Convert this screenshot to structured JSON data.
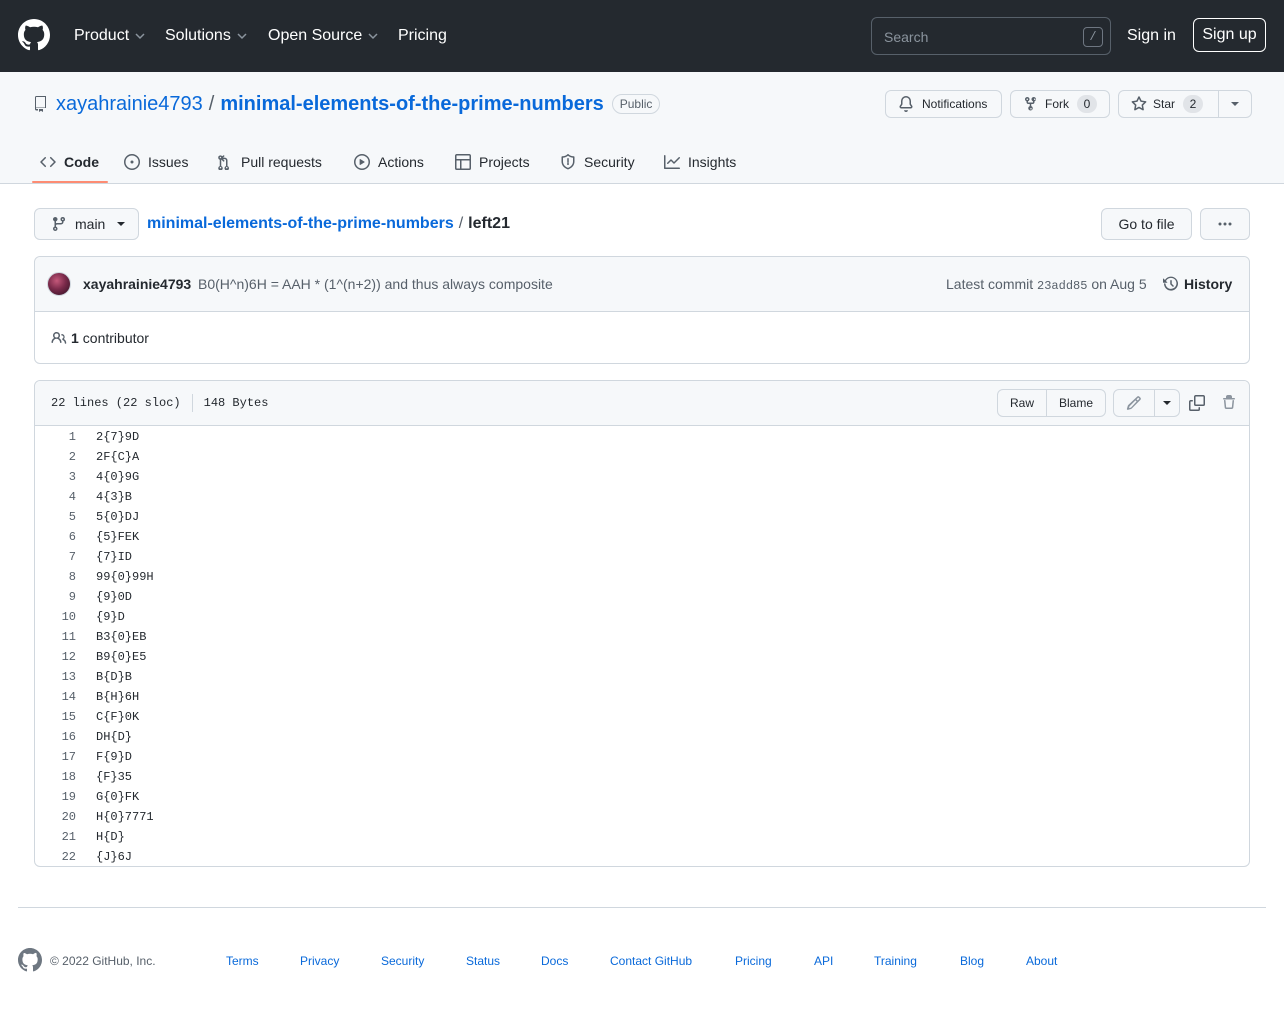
{
  "header": {
    "nav": [
      {
        "label": "Product"
      },
      {
        "label": "Solutions"
      },
      {
        "label": "Open Source"
      },
      {
        "label": "Pricing"
      }
    ],
    "search_placeholder": "Search",
    "search_shortcut": "/",
    "sign_in": "Sign in",
    "sign_up": "Sign up"
  },
  "repo": {
    "owner": "xayahrainie4793",
    "separator": "/",
    "name": "minimal-elements-of-the-prime-numbers",
    "visibility": "Public",
    "notifications_label": "Notifications",
    "fork_label": "Fork",
    "fork_count": "0",
    "star_label": "Star",
    "star_count": "2"
  },
  "tabs": [
    {
      "label": "Code",
      "icon": "code-icon",
      "active": true
    },
    {
      "label": "Issues",
      "icon": "issue-opened-icon"
    },
    {
      "label": "Pull requests",
      "icon": "git-pull-request-icon"
    },
    {
      "label": "Actions",
      "icon": "play-icon"
    },
    {
      "label": "Projects",
      "icon": "table-icon"
    },
    {
      "label": "Security",
      "icon": "shield-icon"
    },
    {
      "label": "Insights",
      "icon": "graph-icon"
    }
  ],
  "file_nav": {
    "branch": "main",
    "breadcrumb_repo": "minimal-elements-of-the-prime-numbers",
    "breadcrumb_sep": "/",
    "file_name": "left21",
    "go_to_file": "Go to file"
  },
  "commit": {
    "author": "xayahrainie4793",
    "message": "B0(H^n)6H = AAH * (1^(n+2)) and thus always composite",
    "latest_label": "Latest commit",
    "sha": "23add85",
    "date": "on Aug 5",
    "history_label": "History",
    "contributors_count": "1",
    "contributors_label": "contributor"
  },
  "file": {
    "lines_info": "22 lines (22 sloc)",
    "size": "148 Bytes",
    "raw_label": "Raw",
    "blame_label": "Blame",
    "lines": [
      "2{7}9D",
      "2F{C}A",
      "4{0}9G",
      "4{3}B",
      "5{0}DJ",
      "{5}FEK",
      "{7}ID",
      "99{0}99H",
      "{9}0D",
      "{9}D",
      "B3{0}EB",
      "B9{0}E5",
      "B{D}B",
      "B{H}6H",
      "C{F}0K",
      "DH{D}",
      "F{9}D",
      "{F}35",
      "G{0}FK",
      "H{0}7771",
      "H{D}",
      "{J}6J"
    ]
  },
  "footer": {
    "copyright": "© 2022 GitHub, Inc.",
    "links": [
      "Terms",
      "Privacy",
      "Security",
      "Status",
      "Docs",
      "Contact GitHub",
      "Pricing",
      "API",
      "Training",
      "Blog",
      "About"
    ]
  },
  "colors": {
    "header_bg": "#24292f",
    "link_blue": "#0969da",
    "tab_underline": "#fd8c73",
    "border": "#d0d7de",
    "subtle_bg": "#f6f8fa"
  }
}
